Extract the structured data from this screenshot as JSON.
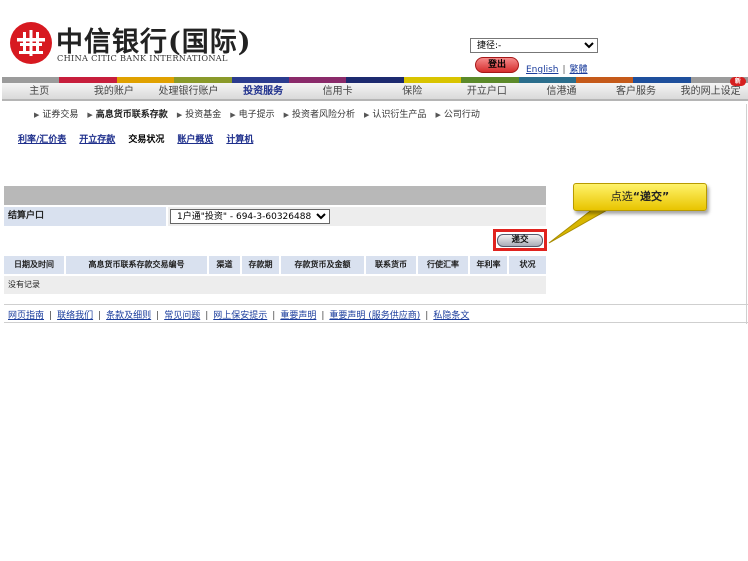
{
  "header": {
    "brand_cn": "中信银行(国际)",
    "brand_en": "CHINA CITIC BANK INTERNATIONAL",
    "shortcut_value": "捷径:-",
    "logout_label": "登出",
    "lang_english": "English",
    "lang_separator": "|",
    "lang_traditional": "繁體"
  },
  "nav": {
    "strip_colors": [
      "#9b9b9b",
      "#c71e3c",
      "#e0a100",
      "#8a9a2a",
      "#2b3c8e",
      "#8a2a6a",
      "#1d2a6f",
      "#d9c400",
      "#5c8a2a",
      "#2b6e8c",
      "#c55a1a",
      "#1e4f9c",
      "#9b9b9b"
    ],
    "items": [
      {
        "label": "主页"
      },
      {
        "label": "我的账户"
      },
      {
        "label": "处理银行账户"
      },
      {
        "label": "投资服务"
      },
      {
        "label": "信用卡"
      },
      {
        "label": "保险"
      },
      {
        "label": "开立户口"
      },
      {
        "label": "信港通"
      },
      {
        "label": "客户服务"
      },
      {
        "label": "我的网上设定"
      }
    ],
    "new_badge": "新"
  },
  "subnav": {
    "items": [
      {
        "label": "证券交易"
      },
      {
        "label": "高息货币联系存款"
      },
      {
        "label": "投资基金"
      },
      {
        "label": "电子提示"
      },
      {
        "label": "投资者风险分析"
      },
      {
        "label": "认识衍生产品"
      },
      {
        "label": "公司行动"
      }
    ]
  },
  "tabs": [
    {
      "label": "利率/汇价表"
    },
    {
      "label": "开立存款"
    },
    {
      "label": "交易状况"
    },
    {
      "label": "账户概览"
    },
    {
      "label": "计算机"
    }
  ],
  "form": {
    "account_label": "结算户口",
    "account_value": "1户通\"投资\" - 694-3-60326488",
    "submit_label": "递交"
  },
  "table": {
    "columns": [
      "日期及时间",
      "高息货币联系存款交易编号",
      "渠道",
      "存款期",
      "存款货币及金额",
      "联系货币",
      "行使汇率",
      "年利率",
      "状况"
    ],
    "empty_text": "没有记录"
  },
  "footer": {
    "links": [
      "网页指南",
      "联络我们",
      "条款及细则",
      "常见问题",
      "网上保安提示",
      "重要声明",
      "重要声明 (服务供应商)",
      "私隐条文"
    ],
    "separator": "|"
  },
  "callout": {
    "prefix": "点选",
    "highlight": "“递交”"
  }
}
